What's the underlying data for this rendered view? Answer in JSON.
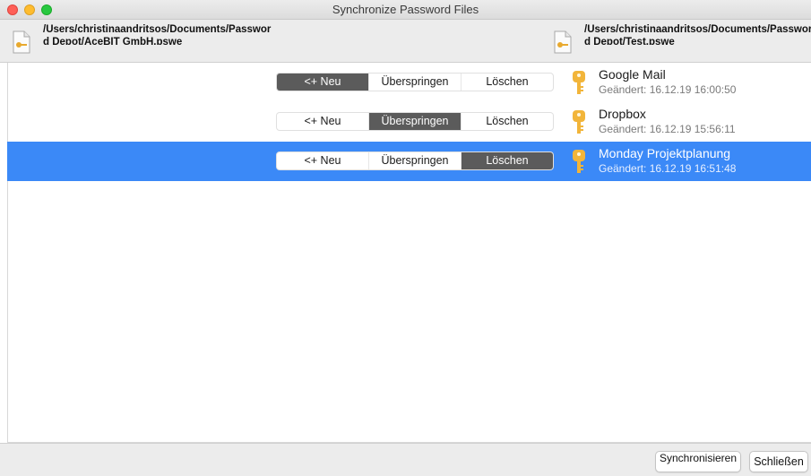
{
  "window": {
    "title": "Synchronize Password Files"
  },
  "header": {
    "left_path": "/Users/christinaandritsos/Documents/Password Depot/AceBIT GmbH.pswe",
    "right_path": "/Users/christinaandritsos/Documents/Password Depot/Test.pswe"
  },
  "segment_labels": {
    "new": "<+ Neu",
    "skip": "Überspringen",
    "delete": "Löschen"
  },
  "rows": [
    {
      "name": "Google Mail",
      "changed": "Geändert: 16.12.19 16:00:50",
      "action": "new",
      "selected": false
    },
    {
      "name": "Dropbox",
      "changed": "Geändert: 16.12.19 15:56:11",
      "action": "skip",
      "selected": false
    },
    {
      "name": "Monday Projektplanung",
      "changed": "Geändert: 16.12.19 16:51:48",
      "action": "delete",
      "selected": true
    }
  ],
  "footer": {
    "sync_label": "Synchronisieren",
    "close_label": "Schließen"
  },
  "colors": {
    "selection": "#3b89f7",
    "segment_active": "#5b5b5b",
    "key": "#f2b53a"
  },
  "icons": {
    "file": "file-icon",
    "key": "key-icon"
  }
}
